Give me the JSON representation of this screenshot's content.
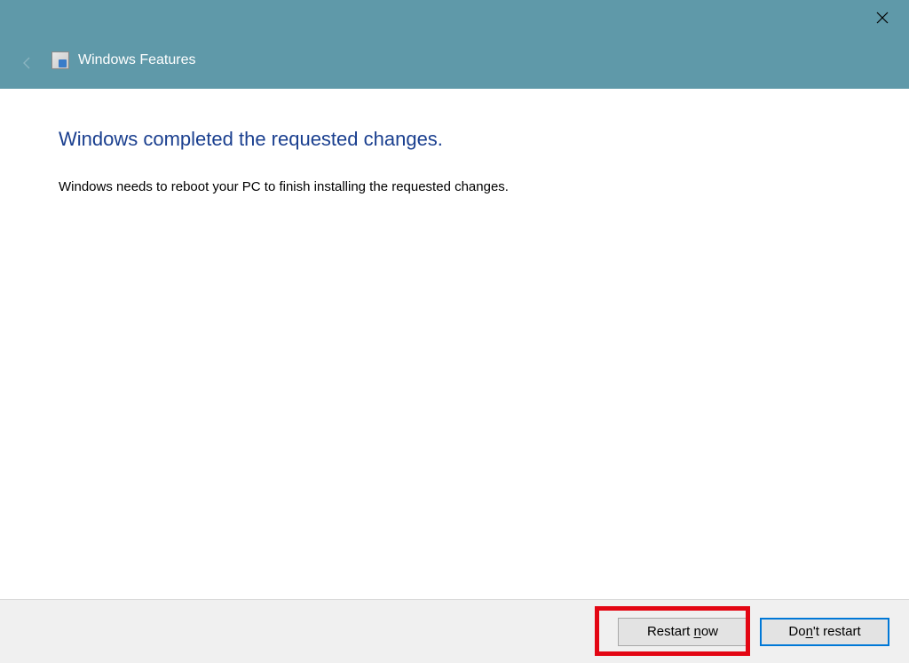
{
  "titlebar": {
    "title": "Windows Features",
    "close_icon_name": "close-icon",
    "back_icon_name": "back-arrow-icon",
    "app_icon_name": "windows-features-icon"
  },
  "content": {
    "heading": "Windows completed the requested changes.",
    "body": "Windows needs to reboot your PC to finish installing the requested changes."
  },
  "buttons": {
    "restart_prefix": "Restart ",
    "restart_accel": "n",
    "restart_suffix": "ow",
    "dont_prefix": "Do",
    "dont_accel": "n",
    "dont_suffix": "'t restart"
  },
  "annotations": {
    "highlighted_button": "restart-now-button"
  }
}
